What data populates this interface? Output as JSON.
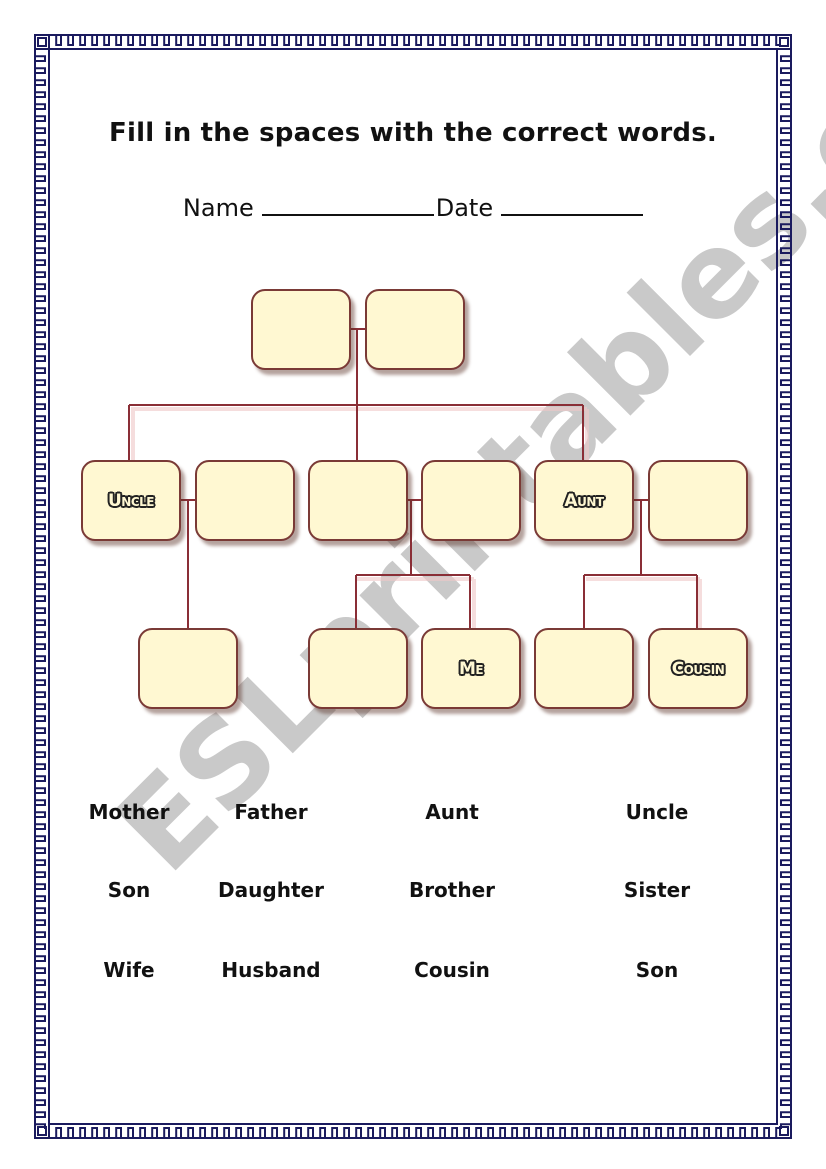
{
  "worksheet": {
    "title": "Fill in the spaces with the correct words.",
    "name_label": "Name",
    "date_label": "Date",
    "watermark": "ESLprintables.com"
  },
  "family_tree": {
    "grandparents": [
      {
        "label": ""
      },
      {
        "label": ""
      }
    ],
    "generation2": [
      {
        "label": "Uncle"
      },
      {
        "label": ""
      },
      {
        "label": ""
      },
      {
        "label": ""
      },
      {
        "label": "Aunt"
      },
      {
        "label": ""
      }
    ],
    "generation3": [
      {
        "label": ""
      },
      {
        "label": ""
      },
      {
        "label": "Me"
      },
      {
        "label": ""
      },
      {
        "label": "Cousin"
      }
    ]
  },
  "word_bank": {
    "rows": [
      [
        "Mother",
        "Father",
        "Aunt",
        "Uncle"
      ],
      [
        "Son",
        "Daughter",
        "Brother",
        "Sister"
      ],
      [
        "Wife",
        "Husband",
        "Cousin",
        "Son"
      ]
    ]
  },
  "colors": {
    "border": "#1a1a5e",
    "box_fill": "#fff8d2",
    "box_stroke": "#7a3a36",
    "connector": "#8a2e36",
    "watermark": "#c8c8c8"
  }
}
